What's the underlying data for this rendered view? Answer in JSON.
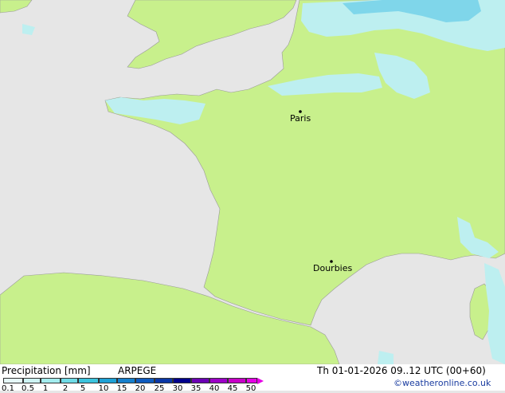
{
  "title": "Precipitation [mm]",
  "model": "ARPEGE",
  "valid_time": "Th 01-01-2026 09..12 UTC (00+60)",
  "credit": "©weatheronline.co.uk",
  "cities": [
    {
      "name": "Paris"
    },
    {
      "name": "Dourbies"
    }
  ],
  "legend": {
    "ticks": [
      "0.1",
      "0.5",
      "1",
      "2",
      "5",
      "10",
      "15",
      "20",
      "25",
      "30",
      "35",
      "40",
      "45",
      "50"
    ],
    "colors": [
      "#e6f8f8",
      "#cdf3f3",
      "#a3ecee",
      "#6fdbe6",
      "#3cc3dd",
      "#1ea1d6",
      "#167fcc",
      "#0f5bbf",
      "#0a37a6",
      "#00008c",
      "#6b00b4",
      "#9c00c8",
      "#c800c8",
      "#e600e6"
    ]
  },
  "colors": {
    "land": "#c8f08c",
    "sea": "#e6e6e6",
    "precip_light": "#bdeff0",
    "precip_mid": "#7fd6ea"
  },
  "chart_data": {
    "type": "heatmap",
    "variable": "Precipitation",
    "units": "mm",
    "model": "ARPEGE",
    "valid": "Th 01-01-2026 09..12 UTC (00+60)"
  }
}
